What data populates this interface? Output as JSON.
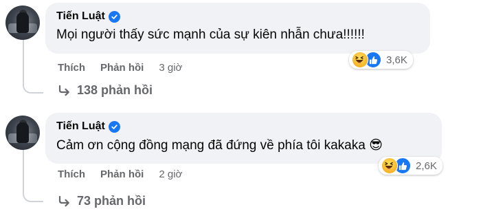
{
  "comments": [
    {
      "author": "Tiến Luật",
      "text": "Mọi người thấy sức mạnh của sự kiên nhẫn chưa!!!!!!",
      "reaction_count": "3,6K",
      "reactions": [
        "haha",
        "like"
      ],
      "like_label": "Thích",
      "reply_label": "Phản hồi",
      "time": "3 giờ",
      "replies_label": "138 phản hồi"
    },
    {
      "author": "Tiến Luật",
      "text": "Cảm ơn cộng đồng mạng đã đứng về phía tôi kakaka 😎",
      "reaction_count": "2,6K",
      "reactions": [
        "haha",
        "like"
      ],
      "like_label": "Thích",
      "reply_label": "Phản hồi",
      "time": "2 giờ",
      "replies_label": "73 phản hồi"
    }
  ],
  "colors": {
    "bubble": "#f0f2f5",
    "muted_text": "#65676b",
    "verified_blue": "#1877f2",
    "haha_yellow": "#f7b125"
  }
}
